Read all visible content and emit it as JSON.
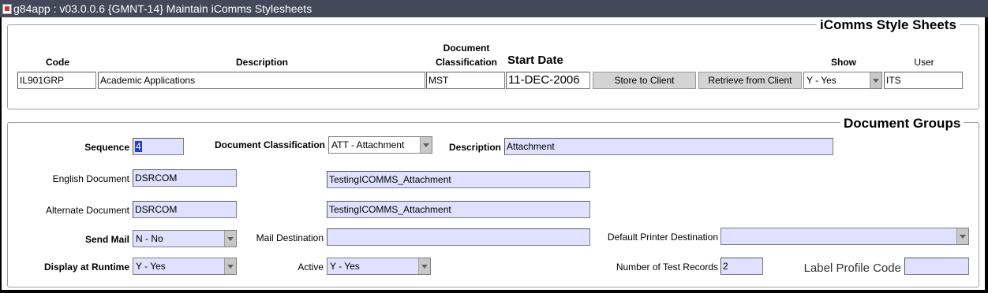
{
  "window": {
    "title": "g84app : v03.0.0.6  {GMNT-14} Maintain iComms Stylesheets"
  },
  "stylesheets": {
    "title": "iComms Style Sheets",
    "labels": {
      "code": "Code",
      "description": "Description",
      "doc_class_1": "Document",
      "doc_class_2": "Classification",
      "start_date": "Start Date",
      "show": "Show",
      "user": "User"
    },
    "values": {
      "code": "IL901GRP",
      "description": "Academic Applications",
      "doc_class": "MST",
      "start_date": "11-DEC-2006",
      "show": "Y - Yes",
      "user": "ITS"
    },
    "buttons": {
      "store": "Store to Client",
      "retrieve": "Retrieve from Client"
    }
  },
  "groups": {
    "title": "Document Groups",
    "labels": {
      "sequence": "Sequence",
      "doc_class": "Document Classification",
      "description": "Description",
      "english_doc": "English Document",
      "alternate_doc": "Alternate Document",
      "send_mail": "Send Mail",
      "mail_dest": "Mail Destination",
      "default_printer": "Default Printer Destination",
      "display_runtime": "Display at Runtime",
      "active": "Active",
      "num_test": "Number of Test Records",
      "label_profile": "Label Profile Code"
    },
    "values": {
      "sequence": "4",
      "doc_class": "ATT - Attachment",
      "description": "Attachment",
      "english_doc": "DSRCOM",
      "english_doc_name": "TestingICOMMS_Attachment",
      "alternate_doc": "DSRCOM",
      "alternate_doc_name": "TestingICOMMS_Attachment",
      "send_mail": "N - No",
      "mail_dest": "",
      "default_printer": "",
      "display_runtime": "Y - Yes",
      "active": "Y - Yes",
      "num_test": "2",
      "label_profile": ""
    }
  }
}
